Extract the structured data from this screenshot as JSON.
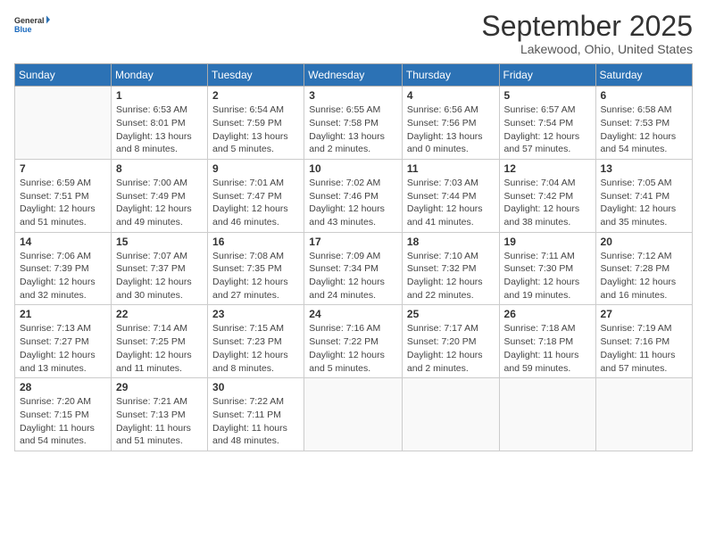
{
  "logo": {
    "general": "General",
    "blue": "Blue"
  },
  "header": {
    "month": "September 2025",
    "location": "Lakewood, Ohio, United States"
  },
  "days_of_week": [
    "Sunday",
    "Monday",
    "Tuesday",
    "Wednesday",
    "Thursday",
    "Friday",
    "Saturday"
  ],
  "weeks": [
    [
      {
        "num": "",
        "info": ""
      },
      {
        "num": "1",
        "info": "Sunrise: 6:53 AM\nSunset: 8:01 PM\nDaylight: 13 hours\nand 8 minutes."
      },
      {
        "num": "2",
        "info": "Sunrise: 6:54 AM\nSunset: 7:59 PM\nDaylight: 13 hours\nand 5 minutes."
      },
      {
        "num": "3",
        "info": "Sunrise: 6:55 AM\nSunset: 7:58 PM\nDaylight: 13 hours\nand 2 minutes."
      },
      {
        "num": "4",
        "info": "Sunrise: 6:56 AM\nSunset: 7:56 PM\nDaylight: 13 hours\nand 0 minutes."
      },
      {
        "num": "5",
        "info": "Sunrise: 6:57 AM\nSunset: 7:54 PM\nDaylight: 12 hours\nand 57 minutes."
      },
      {
        "num": "6",
        "info": "Sunrise: 6:58 AM\nSunset: 7:53 PM\nDaylight: 12 hours\nand 54 minutes."
      }
    ],
    [
      {
        "num": "7",
        "info": "Sunrise: 6:59 AM\nSunset: 7:51 PM\nDaylight: 12 hours\nand 51 minutes."
      },
      {
        "num": "8",
        "info": "Sunrise: 7:00 AM\nSunset: 7:49 PM\nDaylight: 12 hours\nand 49 minutes."
      },
      {
        "num": "9",
        "info": "Sunrise: 7:01 AM\nSunset: 7:47 PM\nDaylight: 12 hours\nand 46 minutes."
      },
      {
        "num": "10",
        "info": "Sunrise: 7:02 AM\nSunset: 7:46 PM\nDaylight: 12 hours\nand 43 minutes."
      },
      {
        "num": "11",
        "info": "Sunrise: 7:03 AM\nSunset: 7:44 PM\nDaylight: 12 hours\nand 41 minutes."
      },
      {
        "num": "12",
        "info": "Sunrise: 7:04 AM\nSunset: 7:42 PM\nDaylight: 12 hours\nand 38 minutes."
      },
      {
        "num": "13",
        "info": "Sunrise: 7:05 AM\nSunset: 7:41 PM\nDaylight: 12 hours\nand 35 minutes."
      }
    ],
    [
      {
        "num": "14",
        "info": "Sunrise: 7:06 AM\nSunset: 7:39 PM\nDaylight: 12 hours\nand 32 minutes."
      },
      {
        "num": "15",
        "info": "Sunrise: 7:07 AM\nSunset: 7:37 PM\nDaylight: 12 hours\nand 30 minutes."
      },
      {
        "num": "16",
        "info": "Sunrise: 7:08 AM\nSunset: 7:35 PM\nDaylight: 12 hours\nand 27 minutes."
      },
      {
        "num": "17",
        "info": "Sunrise: 7:09 AM\nSunset: 7:34 PM\nDaylight: 12 hours\nand 24 minutes."
      },
      {
        "num": "18",
        "info": "Sunrise: 7:10 AM\nSunset: 7:32 PM\nDaylight: 12 hours\nand 22 minutes."
      },
      {
        "num": "19",
        "info": "Sunrise: 7:11 AM\nSunset: 7:30 PM\nDaylight: 12 hours\nand 19 minutes."
      },
      {
        "num": "20",
        "info": "Sunrise: 7:12 AM\nSunset: 7:28 PM\nDaylight: 12 hours\nand 16 minutes."
      }
    ],
    [
      {
        "num": "21",
        "info": "Sunrise: 7:13 AM\nSunset: 7:27 PM\nDaylight: 12 hours\nand 13 minutes."
      },
      {
        "num": "22",
        "info": "Sunrise: 7:14 AM\nSunset: 7:25 PM\nDaylight: 12 hours\nand 11 minutes."
      },
      {
        "num": "23",
        "info": "Sunrise: 7:15 AM\nSunset: 7:23 PM\nDaylight: 12 hours\nand 8 minutes."
      },
      {
        "num": "24",
        "info": "Sunrise: 7:16 AM\nSunset: 7:22 PM\nDaylight: 12 hours\nand 5 minutes."
      },
      {
        "num": "25",
        "info": "Sunrise: 7:17 AM\nSunset: 7:20 PM\nDaylight: 12 hours\nand 2 minutes."
      },
      {
        "num": "26",
        "info": "Sunrise: 7:18 AM\nSunset: 7:18 PM\nDaylight: 11 hours\nand 59 minutes."
      },
      {
        "num": "27",
        "info": "Sunrise: 7:19 AM\nSunset: 7:16 PM\nDaylight: 11 hours\nand 57 minutes."
      }
    ],
    [
      {
        "num": "28",
        "info": "Sunrise: 7:20 AM\nSunset: 7:15 PM\nDaylight: 11 hours\nand 54 minutes."
      },
      {
        "num": "29",
        "info": "Sunrise: 7:21 AM\nSunset: 7:13 PM\nDaylight: 11 hours\nand 51 minutes."
      },
      {
        "num": "30",
        "info": "Sunrise: 7:22 AM\nSunset: 7:11 PM\nDaylight: 11 hours\nand 48 minutes."
      },
      {
        "num": "",
        "info": ""
      },
      {
        "num": "",
        "info": ""
      },
      {
        "num": "",
        "info": ""
      },
      {
        "num": "",
        "info": ""
      }
    ]
  ]
}
